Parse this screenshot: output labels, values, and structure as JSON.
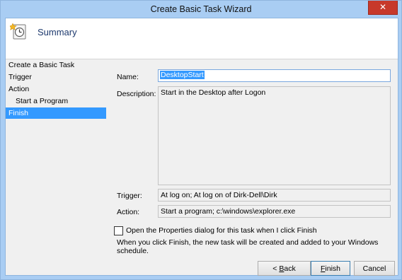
{
  "window": {
    "title": "Create Basic Task Wizard",
    "close_label": "✕"
  },
  "header": {
    "title": "Summary",
    "icon": "task-scheduler-icon"
  },
  "nav": {
    "items": [
      {
        "label": "Create a Basic Task"
      },
      {
        "label": "Trigger"
      },
      {
        "label": "Action"
      },
      {
        "label": "Start a Program"
      },
      {
        "label": "Finish"
      }
    ]
  },
  "form": {
    "name_label": "Name:",
    "name_value": "DesktopStart",
    "description_label": "Description:",
    "description_value": "Start in the Desktop after Logon",
    "trigger_label": "Trigger:",
    "trigger_value": "At log on; At log on of Dirk-Dell\\Dirk",
    "action_label": "Action:",
    "action_value": "Start a program; c:\\windows\\explorer.exe"
  },
  "options": {
    "open_properties_label": "Open the Properties dialog for this task when I click Finish",
    "open_properties_checked": false,
    "info_text": "When you click Finish, the new task will be created and added to your Windows schedule."
  },
  "buttons": {
    "back_prefix": "< ",
    "back_key": "B",
    "back_rest": "ack",
    "finish_key": "F",
    "finish_rest": "inish",
    "cancel": "Cancel"
  },
  "colors": {
    "accent": "#3399ff",
    "title_bar": "#a9cdf3",
    "close_button": "#c7392b"
  }
}
